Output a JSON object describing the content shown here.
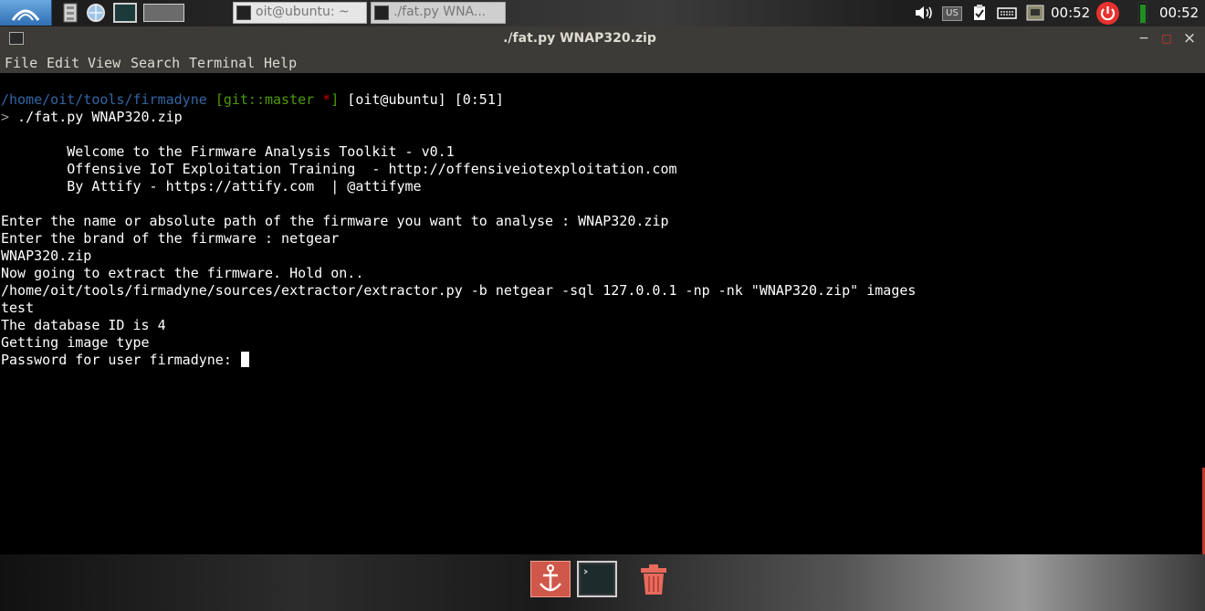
{
  "panel": {
    "taskbar_items": [
      {
        "label": "oit@ubuntu: ~"
      },
      {
        "label": "./fat.py WNA..."
      }
    ],
    "clock_primary": "00:52",
    "clock_secondary": "00:52",
    "keyboard_layout": "US"
  },
  "window": {
    "title": "./fat.py WNAP320.zip",
    "minimize_symbol": "−",
    "maximize_symbol": "□",
    "close_symbol": "×"
  },
  "menu": {
    "items": [
      "File",
      "Edit",
      "View",
      "Search",
      "Terminal",
      "Help"
    ]
  },
  "terminal": {
    "prompt_path": "/home/oit/tools/firmadyne",
    "prompt_git": "[git::master ",
    "prompt_star": "*",
    "prompt_git_close": "]",
    "prompt_user": " [oit@ubuntu] [0:51]",
    "prompt_symbol": ">",
    "command": " ./fat.py WNAP320.zip",
    "lines": [
      "        Welcome to the Firmware Analysis Toolkit - v0.1",
      "        Offensive IoT Exploitation Training  - http://offensiveiotexploitation.com",
      "        By Attify - https://attify.com  | @attifyme",
      "Enter the name or absolute path of the firmware you want to analyse : WNAP320.zip",
      "Enter the brand of the firmware : netgear",
      "WNAP320.zip",
      "Now going to extract the firmware. Hold on..",
      "/home/oit/tools/firmadyne/sources/extractor/extractor.py -b netgear -sql 127.0.0.1 -np -nk \"WNAP320.zip\" images",
      "test",
      "The database ID is 4",
      "Getting image type"
    ],
    "password_prompt": "Password for user firmadyne: "
  },
  "dock": {
    "items": [
      "anchor-icon",
      "terminal-icon",
      "trash-icon"
    ]
  },
  "colors": {
    "path": "#3465a4",
    "git": "#4e9a06",
    "star": "#cc0000",
    "titlebar": "#3c3b37",
    "terminal_bg": "#000000"
  }
}
